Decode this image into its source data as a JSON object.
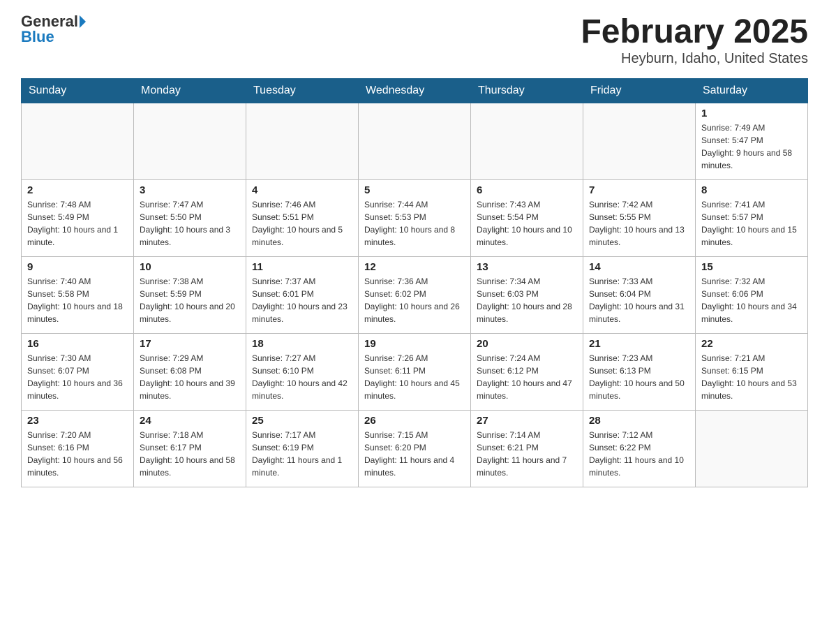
{
  "header": {
    "logo_general": "General",
    "logo_blue": "Blue",
    "title": "February 2025",
    "subtitle": "Heyburn, Idaho, United States"
  },
  "calendar": {
    "headers": [
      "Sunday",
      "Monday",
      "Tuesday",
      "Wednesday",
      "Thursday",
      "Friday",
      "Saturday"
    ],
    "weeks": [
      [
        {
          "day": "",
          "info": ""
        },
        {
          "day": "",
          "info": ""
        },
        {
          "day": "",
          "info": ""
        },
        {
          "day": "",
          "info": ""
        },
        {
          "day": "",
          "info": ""
        },
        {
          "day": "",
          "info": ""
        },
        {
          "day": "1",
          "info": "Sunrise: 7:49 AM\nSunset: 5:47 PM\nDaylight: 9 hours and 58 minutes."
        }
      ],
      [
        {
          "day": "2",
          "info": "Sunrise: 7:48 AM\nSunset: 5:49 PM\nDaylight: 10 hours and 1 minute."
        },
        {
          "day": "3",
          "info": "Sunrise: 7:47 AM\nSunset: 5:50 PM\nDaylight: 10 hours and 3 minutes."
        },
        {
          "day": "4",
          "info": "Sunrise: 7:46 AM\nSunset: 5:51 PM\nDaylight: 10 hours and 5 minutes."
        },
        {
          "day": "5",
          "info": "Sunrise: 7:44 AM\nSunset: 5:53 PM\nDaylight: 10 hours and 8 minutes."
        },
        {
          "day": "6",
          "info": "Sunrise: 7:43 AM\nSunset: 5:54 PM\nDaylight: 10 hours and 10 minutes."
        },
        {
          "day": "7",
          "info": "Sunrise: 7:42 AM\nSunset: 5:55 PM\nDaylight: 10 hours and 13 minutes."
        },
        {
          "day": "8",
          "info": "Sunrise: 7:41 AM\nSunset: 5:57 PM\nDaylight: 10 hours and 15 minutes."
        }
      ],
      [
        {
          "day": "9",
          "info": "Sunrise: 7:40 AM\nSunset: 5:58 PM\nDaylight: 10 hours and 18 minutes."
        },
        {
          "day": "10",
          "info": "Sunrise: 7:38 AM\nSunset: 5:59 PM\nDaylight: 10 hours and 20 minutes."
        },
        {
          "day": "11",
          "info": "Sunrise: 7:37 AM\nSunset: 6:01 PM\nDaylight: 10 hours and 23 minutes."
        },
        {
          "day": "12",
          "info": "Sunrise: 7:36 AM\nSunset: 6:02 PM\nDaylight: 10 hours and 26 minutes."
        },
        {
          "day": "13",
          "info": "Sunrise: 7:34 AM\nSunset: 6:03 PM\nDaylight: 10 hours and 28 minutes."
        },
        {
          "day": "14",
          "info": "Sunrise: 7:33 AM\nSunset: 6:04 PM\nDaylight: 10 hours and 31 minutes."
        },
        {
          "day": "15",
          "info": "Sunrise: 7:32 AM\nSunset: 6:06 PM\nDaylight: 10 hours and 34 minutes."
        }
      ],
      [
        {
          "day": "16",
          "info": "Sunrise: 7:30 AM\nSunset: 6:07 PM\nDaylight: 10 hours and 36 minutes."
        },
        {
          "day": "17",
          "info": "Sunrise: 7:29 AM\nSunset: 6:08 PM\nDaylight: 10 hours and 39 minutes."
        },
        {
          "day": "18",
          "info": "Sunrise: 7:27 AM\nSunset: 6:10 PM\nDaylight: 10 hours and 42 minutes."
        },
        {
          "day": "19",
          "info": "Sunrise: 7:26 AM\nSunset: 6:11 PM\nDaylight: 10 hours and 45 minutes."
        },
        {
          "day": "20",
          "info": "Sunrise: 7:24 AM\nSunset: 6:12 PM\nDaylight: 10 hours and 47 minutes."
        },
        {
          "day": "21",
          "info": "Sunrise: 7:23 AM\nSunset: 6:13 PM\nDaylight: 10 hours and 50 minutes."
        },
        {
          "day": "22",
          "info": "Sunrise: 7:21 AM\nSunset: 6:15 PM\nDaylight: 10 hours and 53 minutes."
        }
      ],
      [
        {
          "day": "23",
          "info": "Sunrise: 7:20 AM\nSunset: 6:16 PM\nDaylight: 10 hours and 56 minutes."
        },
        {
          "day": "24",
          "info": "Sunrise: 7:18 AM\nSunset: 6:17 PM\nDaylight: 10 hours and 58 minutes."
        },
        {
          "day": "25",
          "info": "Sunrise: 7:17 AM\nSunset: 6:19 PM\nDaylight: 11 hours and 1 minute."
        },
        {
          "day": "26",
          "info": "Sunrise: 7:15 AM\nSunset: 6:20 PM\nDaylight: 11 hours and 4 minutes."
        },
        {
          "day": "27",
          "info": "Sunrise: 7:14 AM\nSunset: 6:21 PM\nDaylight: 11 hours and 7 minutes."
        },
        {
          "day": "28",
          "info": "Sunrise: 7:12 AM\nSunset: 6:22 PM\nDaylight: 11 hours and 10 minutes."
        },
        {
          "day": "",
          "info": ""
        }
      ]
    ]
  }
}
